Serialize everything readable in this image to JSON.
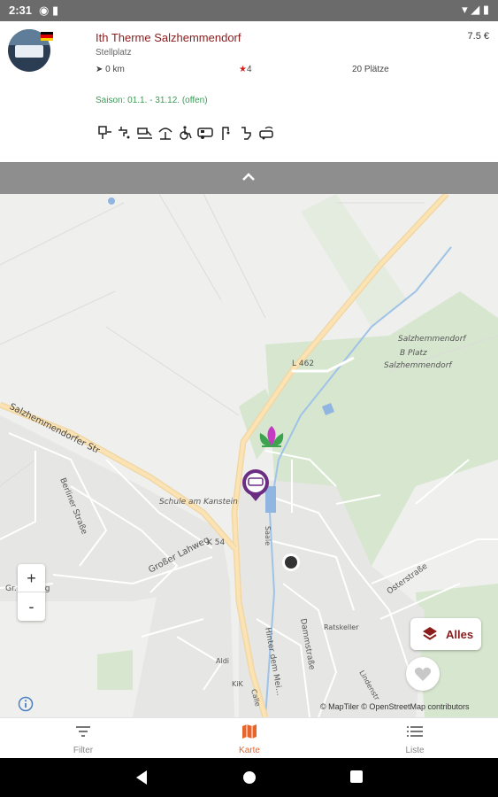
{
  "status_bar": {
    "time": "2:31"
  },
  "place": {
    "name": "Ith Therme Salzhemmendorf",
    "type": "Stellplatz",
    "price": "7.5 €",
    "distance": "0 km",
    "rating": "4",
    "places": "20 Plätze",
    "season": "Saison: 01.1. - 31.12. (offen)",
    "amenity_icons": [
      "power-plug-icon",
      "water-tap-icon",
      "dump-station-icon",
      "shower-icon",
      "accessible-icon",
      "caravan-icon",
      "lamp-icon",
      "toilet-icon",
      "wifi-vehicle-icon"
    ]
  },
  "map": {
    "labels": {
      "road_1": "Salzhemmendorfer Str",
      "road_2": "Berliner Straße",
      "road_3": "Großer Lahweg",
      "road_4": "Gr. Lahweg",
      "road_5": "L 462",
      "road_6": "K 54",
      "school": "Schule am Kanstein",
      "village_1": "Salzhemmendorf",
      "village_2": "B Platz",
      "village_3": "Salzhemmendorf",
      "street_saale": "Saale",
      "street_oster": "Osterstraße",
      "street_hinter": "Hinter dem Mei...",
      "street_ratsk": "Ratskeller",
      "street_damm": "Dammstraße",
      "street_lind": "Lindenstr",
      "aldi": "Aldi",
      "kik": "KiK",
      "road_c": "Calle"
    },
    "zoom_in": "+",
    "zoom_out": "-",
    "filter_all": "Alles",
    "attribution": "© MapTiler © OpenStreetMap contributors"
  },
  "bottom_nav": {
    "filter": "Filter",
    "map": "Karte",
    "list": "Liste"
  },
  "colors": {
    "accent": "#e7652a",
    "title": "#8a1c1c",
    "season": "#3a9a55"
  }
}
